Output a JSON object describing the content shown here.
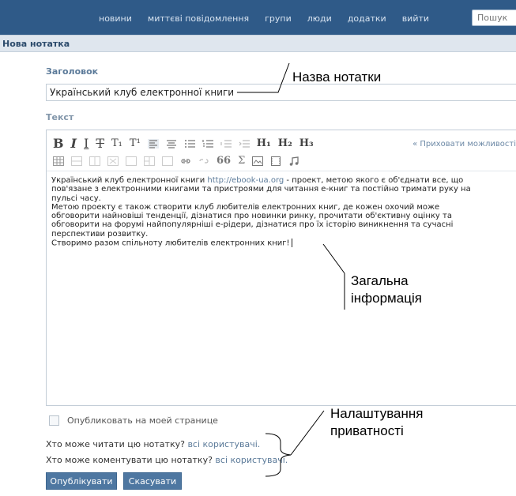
{
  "nav": {
    "items": [
      "новини",
      "миттєві повідомлення",
      "групи",
      "люди",
      "додатки",
      "вийти"
    ],
    "search_placeholder": "Пошук"
  },
  "page": {
    "title": "Нова нотатка"
  },
  "form": {
    "title_label": "Заголовок",
    "title_value": "Український клуб електронної книги",
    "text_label": "Текст",
    "hide_options": "« Приховати можливості",
    "body": {
      "line1_a": "Український клуб електронної книги ",
      "line1_link": "http://ebook-ua.org",
      "line1_b": " - проект, метою якого є об'єднати все, що",
      "line2": "пов'язане з електронними книгами та пристроями для читання е-книг та постійно тримати руку на",
      "line3": "пульсі часу.",
      "line4": "Метою проекту є також створити клуб любителів електронних книг, де кожен охочий може",
      "line5": "обговорити найновіші тенденції, дізнатися про новинки ринку, прочитати об'єктивну оцінку та",
      "line6": "обговорити на форумі найпопулярніші е-рідери, дізнатися про їх історію виникнення та сучасні",
      "line7": "перспективи розвитку.",
      "line8": "Створимо разом спільноту любителів електронних книг!"
    },
    "publish_checkbox_label": "Опубликовать на моей странице",
    "who_read_label": "Хто може читати цю нотатку?",
    "who_read_value": "всі користувачі.",
    "who_comment_label": "Хто може коментувати цю нотатку?",
    "who_comment_value": "всі користувачі.",
    "publish_button": "Опублікувати",
    "cancel_button": "Скасувати"
  },
  "toolbar": {
    "bold": "B",
    "italic": "I",
    "underline": "I",
    "strike": "T",
    "subscript": "T₁",
    "superscript": "T¹",
    "h1": "H₁",
    "h2": "H₂",
    "h3": "H₃",
    "quote": "66",
    "sigma": "Σ"
  },
  "annotations": {
    "title_note": "Назва нотатки",
    "info_note_1": "Загальна",
    "info_note_2": "інформація",
    "privacy_note_1": "Налаштування",
    "privacy_note_2": "приватності"
  },
  "colors": {
    "topbar": "#2f5a88",
    "button": "#4e77a1",
    "link": "#5b7a99"
  }
}
